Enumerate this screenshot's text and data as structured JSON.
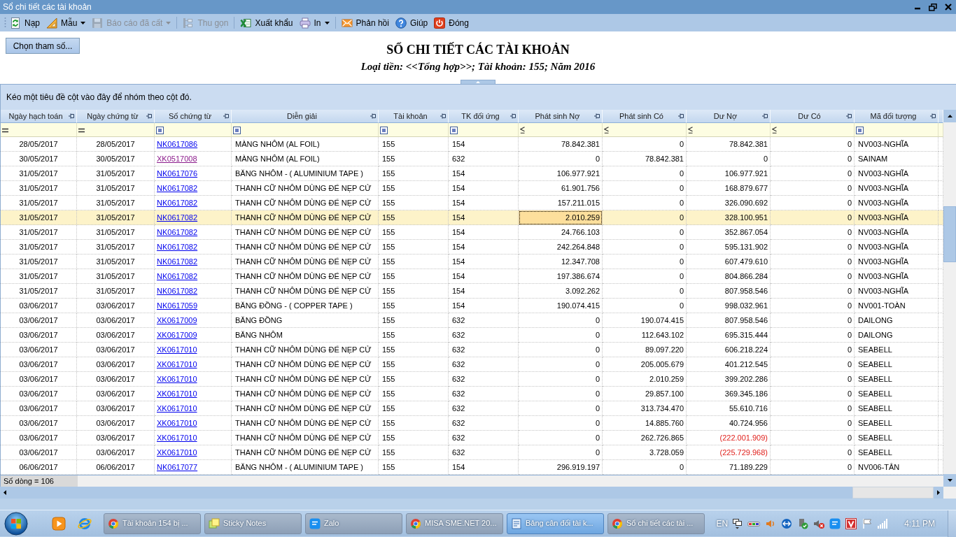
{
  "window": {
    "title": "Sổ chi tiết các tài khoản"
  },
  "toolbar": [
    {
      "kind": "button",
      "label": "Nạp",
      "disabled": false
    },
    {
      "kind": "dropdown",
      "label": "Mẫu",
      "disabled": false
    },
    {
      "kind": "dropdown",
      "label": "Báo cáo đã cất",
      "disabled": true
    },
    {
      "kind": "separator"
    },
    {
      "kind": "button",
      "label": "Thu gọn",
      "disabled": true
    },
    {
      "kind": "separator"
    },
    {
      "kind": "button",
      "label": "Xuất khẩu",
      "disabled": false
    },
    {
      "kind": "dropdown",
      "label": "In",
      "disabled": false
    },
    {
      "kind": "separator"
    },
    {
      "kind": "button",
      "label": "Phản hồi",
      "disabled": false
    },
    {
      "kind": "button",
      "label": "Giúp",
      "disabled": false
    },
    {
      "kind": "button",
      "label": "Đóng",
      "disabled": false
    }
  ],
  "report": {
    "parameters_button": "Chọn tham số...",
    "title": "SỔ CHI TIẾT CÁC TÀI KHOẢN",
    "subtitle": "Loại tiền: <<Tổng hợp>>; Tài khoản: 155; Năm 2016"
  },
  "table": {
    "group_panel_hint": "Kéo một tiêu đề cột vào đây để nhóm theo cột đó.",
    "columns": [
      {
        "label": "Ngày hạch toán",
        "kind": "date"
      },
      {
        "label": "Ngày chứng từ",
        "kind": "date"
      },
      {
        "label": "Số chứng từ",
        "kind": "link"
      },
      {
        "label": "Diễn giải",
        "kind": "text"
      },
      {
        "label": "Tài khoản",
        "kind": "text"
      },
      {
        "label": "TK đối ứng",
        "kind": "text"
      },
      {
        "label": "Phát sinh Nợ",
        "kind": "number"
      },
      {
        "label": "Phát sinh Có",
        "kind": "number"
      },
      {
        "label": "Dư Nợ",
        "kind": "balance"
      },
      {
        "label": "Dư Có",
        "kind": "number"
      },
      {
        "label": "Mã đối tượng",
        "kind": "text"
      }
    ],
    "rows": [
      {
        "selected": false,
        "link_visited": false,
        "negative": false,
        "cells": [
          "28/05/2017",
          "28/05/2017",
          "NK0617086",
          "MÀNG NHÔM (AL FOIL)",
          "155",
          "154",
          "78.842.381",
          "0",
          "78.842.381",
          "0",
          "NV003-NGHĨA"
        ]
      },
      {
        "selected": false,
        "link_visited": true,
        "negative": false,
        "cells": [
          "30/05/2017",
          "30/05/2017",
          "XK0517008",
          "MÀNG NHÔM (AL FOIL)",
          "155",
          "632",
          "0",
          "78.842.381",
          "0",
          "0",
          "SAINAM"
        ]
      },
      {
        "selected": false,
        "link_visited": false,
        "negative": false,
        "cells": [
          "31/05/2017",
          "31/05/2017",
          "NK0617076",
          "BĂNG NHÔM - ( ALUMINIUM TAPE )",
          "155",
          "154",
          "106.977.921",
          "0",
          "106.977.921",
          "0",
          "NV003-NGHĨA"
        ]
      },
      {
        "selected": false,
        "link_visited": false,
        "negative": false,
        "cells": [
          "31/05/2017",
          "31/05/2017",
          "NK0617082",
          "THANH CỮ NHÔM DÙNG ĐỂ NẸP CỬ",
          "155",
          "154",
          "61.901.756",
          "0",
          "168.879.677",
          "0",
          "NV003-NGHĨA"
        ]
      },
      {
        "selected": false,
        "link_visited": false,
        "negative": false,
        "cells": [
          "31/05/2017",
          "31/05/2017",
          "NK0617082",
          "THANH CỮ NHÔM DÙNG ĐỂ NẸP CỬ",
          "155",
          "154",
          "157.211.015",
          "0",
          "326.090.692",
          "0",
          "NV003-NGHĨA"
        ]
      },
      {
        "selected": true,
        "link_visited": false,
        "negative": false,
        "cells": [
          {
            "text": "31/05/2017",
            "focused": false
          },
          {
            "text": "31/05/2017",
            "focused": false
          },
          {
            "text": "NK0617082",
            "focused": false
          },
          {
            "text": "THANH CỮ NHÔM DÙNG ĐỂ NẸP CỬ",
            "focused": false
          },
          {
            "text": "155",
            "focused": false
          },
          {
            "text": "154",
            "focused": false
          },
          {
            "text": "2.010.259",
            "focused": true
          },
          {
            "text": "0",
            "focused": false
          },
          {
            "text": "328.100.951",
            "focused": false
          },
          {
            "text": "0",
            "focused": false
          },
          {
            "text": "NV003-NGHĨA",
            "focused": false
          }
        ]
      },
      {
        "selected": false,
        "link_visited": false,
        "negative": false,
        "cells": [
          "31/05/2017",
          "31/05/2017",
          "NK0617082",
          "THANH CỮ NHÔM DÙNG ĐỂ NẸP CỬ",
          "155",
          "154",
          "24.766.103",
          "0",
          "352.867.054",
          "0",
          "NV003-NGHĨA"
        ]
      },
      {
        "selected": false,
        "link_visited": false,
        "negative": false,
        "cells": [
          "31/05/2017",
          "31/05/2017",
          "NK0617082",
          "THANH CỮ NHÔM DÙNG ĐỂ NẸP CỬ",
          "155",
          "154",
          "242.264.848",
          "0",
          "595.131.902",
          "0",
          "NV003-NGHĨA"
        ]
      },
      {
        "selected": false,
        "link_visited": false,
        "negative": false,
        "cells": [
          "31/05/2017",
          "31/05/2017",
          "NK0617082",
          "THANH CỮ NHÔM DÙNG ĐỂ NẸP CỬ",
          "155",
          "154",
          "12.347.708",
          "0",
          "607.479.610",
          "0",
          "NV003-NGHĨA"
        ]
      },
      {
        "selected": false,
        "link_visited": false,
        "negative": false,
        "cells": [
          "31/05/2017",
          "31/05/2017",
          "NK0617082",
          "THANH CỮ NHÔM DÙNG ĐỂ NẸP CỬ",
          "155",
          "154",
          "197.386.674",
          "0",
          "804.866.284",
          "0",
          "NV003-NGHĨA"
        ]
      },
      {
        "selected": false,
        "link_visited": false,
        "negative": false,
        "cells": [
          "31/05/2017",
          "31/05/2017",
          "NK0617082",
          "THANH CỮ NHÔM DÙNG ĐỂ NẸP CỬ",
          "155",
          "154",
          "3.092.262",
          "0",
          "807.958.546",
          "0",
          "NV003-NGHĨA"
        ]
      },
      {
        "selected": false,
        "link_visited": false,
        "negative": false,
        "cells": [
          "03/06/2017",
          "03/06/2017",
          "NK0617059",
          "BĂNG ĐỒNG - ( COPPER TAPE )",
          "155",
          "154",
          "190.074.415",
          "0",
          "998.032.961",
          "0",
          "NV001-TOÀN"
        ]
      },
      {
        "selected": false,
        "link_visited": false,
        "negative": false,
        "cells": [
          "03/06/2017",
          "03/06/2017",
          "XK0617009",
          "BĂNG ĐỒNG",
          "155",
          "632",
          "0",
          "190.074.415",
          "807.958.546",
          "0",
          "DAILONG"
        ]
      },
      {
        "selected": false,
        "link_visited": false,
        "negative": false,
        "cells": [
          "03/06/2017",
          "03/06/2017",
          "XK0617009",
          "BĂNG NHÔM",
          "155",
          "632",
          "0",
          "112.643.102",
          "695.315.444",
          "0",
          "DAILONG"
        ]
      },
      {
        "selected": false,
        "link_visited": false,
        "negative": false,
        "cells": [
          "03/06/2017",
          "03/06/2017",
          "XK0617010",
          "THANH CỮ NHÔM DÙNG ĐỂ NẸP CỬ",
          "155",
          "632",
          "0",
          "89.097.220",
          "606.218.224",
          "0",
          "SEABELL"
        ]
      },
      {
        "selected": false,
        "link_visited": false,
        "negative": false,
        "cells": [
          "03/06/2017",
          "03/06/2017",
          "XK0617010",
          "THANH CỮ NHÔM DÙNG ĐỂ NẸP CỬ",
          "155",
          "632",
          "0",
          "205.005.679",
          "401.212.545",
          "0",
          "SEABELL"
        ]
      },
      {
        "selected": false,
        "link_visited": false,
        "negative": false,
        "cells": [
          "03/06/2017",
          "03/06/2017",
          "XK0617010",
          "THANH CỮ NHÔM DÙNG ĐỂ NẸP CỬ",
          "155",
          "632",
          "0",
          "2.010.259",
          "399.202.286",
          "0",
          "SEABELL"
        ]
      },
      {
        "selected": false,
        "link_visited": false,
        "negative": false,
        "cells": [
          "03/06/2017",
          "03/06/2017",
          "XK0617010",
          "THANH CỮ NHÔM DÙNG ĐỂ NẸP CỬ",
          "155",
          "632",
          "0",
          "29.857.100",
          "369.345.186",
          "0",
          "SEABELL"
        ]
      },
      {
        "selected": false,
        "link_visited": false,
        "negative": false,
        "cells": [
          "03/06/2017",
          "03/06/2017",
          "XK0617010",
          "THANH CỮ NHÔM DÙNG ĐỂ NẸP CỬ",
          "155",
          "632",
          "0",
          "313.734.470",
          "55.610.716",
          "0",
          "SEABELL"
        ]
      },
      {
        "selected": false,
        "link_visited": false,
        "negative": false,
        "cells": [
          "03/06/2017",
          "03/06/2017",
          "XK0617010",
          "THANH CỮ NHÔM DÙNG ĐỂ NẸP CỬ",
          "155",
          "632",
          "0",
          "14.885.760",
          "40.724.956",
          "0",
          "SEABELL"
        ]
      },
      {
        "selected": false,
        "link_visited": false,
        "negative": true,
        "cells": [
          "03/06/2017",
          "03/06/2017",
          "XK0617010",
          "THANH CỮ NHÔM DÙNG ĐỂ NẸP CỬ",
          "155",
          "632",
          "0",
          "262.726.865",
          "(222.001.909)",
          "0",
          "SEABELL"
        ]
      },
      {
        "selected": false,
        "link_visited": false,
        "negative": true,
        "cells": [
          "03/06/2017",
          "03/06/2017",
          "XK0617010",
          "THANH CỮ NHÔM DÙNG ĐỂ NẸP CỬ",
          "155",
          "632",
          "0",
          "3.728.059",
          "(225.729.968)",
          "0",
          "SEABELL"
        ]
      },
      {
        "selected": false,
        "link_visited": false,
        "negative": false,
        "cells": [
          "06/06/2017",
          "06/06/2017",
          "NK0617077",
          "BĂNG NHÔM - ( ALUMINIUM TAPE )",
          "155",
          "154",
          "296.919.197",
          "0",
          "71.189.229",
          "0",
          "NV006-TÂN"
        ]
      }
    ],
    "footer": "Số dòng = 106"
  },
  "taskbar": {
    "tasks": [
      {
        "label": "Tài khoản 154 bị ...",
        "kind": "browser",
        "selected": false
      },
      {
        "label": "Sticky Notes",
        "kind": "notes",
        "selected": false
      },
      {
        "label": "Zalo",
        "kind": "chat",
        "selected": false
      },
      {
        "label": "MISA SME.NET 20...",
        "kind": "browser",
        "selected": false
      },
      {
        "label": "Bảng cân đối tài k...",
        "kind": "document",
        "selected": true
      },
      {
        "label": "Sổ chi tiết các tài ...",
        "kind": "browser",
        "selected": false
      }
    ],
    "language": "EN",
    "clock": "4:11 PM"
  }
}
